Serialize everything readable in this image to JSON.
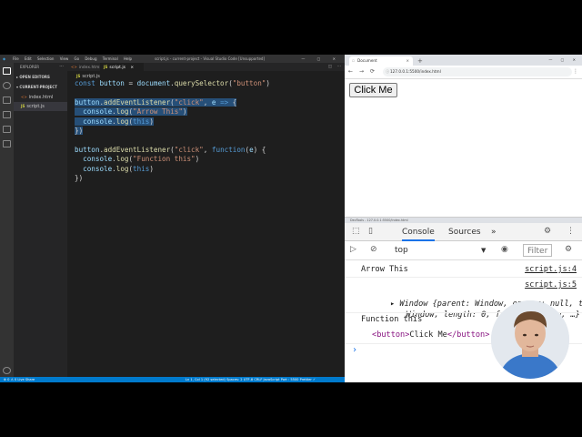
{
  "vscode": {
    "menu": [
      "File",
      "Edit",
      "Selection",
      "View",
      "Go",
      "Debug",
      "Terminal",
      "Help"
    ],
    "window_title": "script.js - current-project - Visual Studio Code [Unsupported]",
    "window_controls": "— ▢ ✕",
    "sidebar": {
      "header": "EXPLORER",
      "open_editors": "▸ OPEN EDITORS",
      "project": "▾ CURRENT-PROJECT",
      "files": [
        {
          "icon": "<>",
          "name": "index.html"
        },
        {
          "icon": "JS",
          "name": "script.js"
        }
      ]
    },
    "tabs": [
      {
        "icon": "<>",
        "label": "index.html"
      },
      {
        "icon": "JS",
        "label": "script.js"
      }
    ],
    "tab_close": "×",
    "breadcrumb": {
      "icon": "JS",
      "label": "script.js"
    },
    "code": [
      {
        "tokens": [
          {
            "t": "const ",
            "c": "kw"
          },
          {
            "t": "button",
            "c": "var"
          },
          {
            "t": " = "
          },
          {
            "t": "document",
            "c": "var"
          },
          {
            "t": "."
          },
          {
            "t": "querySelector",
            "c": "fn"
          },
          {
            "t": "("
          },
          {
            "t": "\"button\"",
            "c": "str"
          },
          {
            "t": ")"
          }
        ]
      },
      {
        "tokens": []
      },
      {
        "sel": true,
        "tokens": [
          {
            "t": "button",
            "c": "var"
          },
          {
            "t": "."
          },
          {
            "t": "addEventListener",
            "c": "fn"
          },
          {
            "t": "("
          },
          {
            "t": "\"click\"",
            "c": "str"
          },
          {
            "t": ", "
          },
          {
            "t": "e",
            "c": "var"
          },
          {
            "t": " "
          },
          {
            "t": "=>",
            "c": "kw"
          },
          {
            "t": " {"
          }
        ]
      },
      {
        "sel": true,
        "tokens": [
          {
            "t": "  "
          },
          {
            "t": "console",
            "c": "var"
          },
          {
            "t": "."
          },
          {
            "t": "log",
            "c": "fn"
          },
          {
            "t": "("
          },
          {
            "t": "\"Arrow This\"",
            "c": "str"
          },
          {
            "t": ")"
          }
        ]
      },
      {
        "sel": true,
        "tokens": [
          {
            "t": "  "
          },
          {
            "t": "console",
            "c": "var"
          },
          {
            "t": "."
          },
          {
            "t": "log",
            "c": "fn"
          },
          {
            "t": "("
          },
          {
            "t": "this",
            "c": "kw"
          },
          {
            "t": ")"
          }
        ]
      },
      {
        "sel": true,
        "tokens": [
          {
            "t": "})"
          }
        ]
      },
      {
        "tokens": []
      },
      {
        "tokens": [
          {
            "t": "button",
            "c": "var"
          },
          {
            "t": "."
          },
          {
            "t": "addEventListener",
            "c": "fn"
          },
          {
            "t": "("
          },
          {
            "t": "\"click\"",
            "c": "str"
          },
          {
            "t": ", "
          },
          {
            "t": "function",
            "c": "kw"
          },
          {
            "t": "("
          },
          {
            "t": "e",
            "c": "var"
          },
          {
            "t": ") {"
          }
        ]
      },
      {
        "tokens": [
          {
            "t": "  "
          },
          {
            "t": "console",
            "c": "var"
          },
          {
            "t": "."
          },
          {
            "t": "log",
            "c": "fn"
          },
          {
            "t": "("
          },
          {
            "t": "\"Function this\"",
            "c": "str"
          },
          {
            "t": ")"
          }
        ]
      },
      {
        "tokens": [
          {
            "t": "  "
          },
          {
            "t": "console",
            "c": "var"
          },
          {
            "t": "."
          },
          {
            "t": "log",
            "c": "fn"
          },
          {
            "t": "("
          },
          {
            "t": "this",
            "c": "kw"
          },
          {
            "t": ")"
          }
        ]
      },
      {
        "tokens": [
          {
            "t": "})"
          }
        ]
      }
    ],
    "status_left": "⊗ 0 ⚠ 0   Live Share",
    "status_right": "Ln 1, Col 1 (92 selected)   Spaces: 2   UTF-8   CRLF   JavaScript   Port : 5500   Prettier ✓"
  },
  "browser": {
    "tab_title": "Document",
    "tab_close": "×",
    "new_tab": "+",
    "window_controls": "— ▢ ✕",
    "nav": {
      "back": "←",
      "forward": "→",
      "reload": "⟳"
    },
    "lock": "ⓘ",
    "url": "127.0.0.1:5500/index.html",
    "menu": "⋮",
    "page_button": "Click Me"
  },
  "devtools": {
    "title": "DevTools - 127.0.0.1:5500/index.html",
    "tabs": [
      "Console",
      "Sources"
    ],
    "more_tabs": "»",
    "context": "top",
    "context_caret": "▼",
    "filter_placeholder": "Filter",
    "entries": [
      {
        "text": "Arrow This",
        "source": "script.js:4"
      },
      {
        "source": "script.js:5"
      },
      {
        "text": "▸ Window {parent: Window, opener: null, top:"
      },
      {
        "text": "  Window, length: 0, frames: Window, …}"
      },
      {
        "text": "Function this"
      },
      {
        "tag_open": "<",
        "tag_name": "button",
        "tag_close": ">",
        "text": "Click Me",
        "end_tag": "</button>"
      }
    ],
    "prompt": "›"
  },
  "colors": {
    "vscode_bg": "#1e1e1e",
    "vscode_status": "#007acc",
    "selection": "#264f78",
    "keyword": "#569cd6",
    "string": "#ce9178",
    "function": "#dcdcaa",
    "devtools_active_tab": "#1a73e8"
  }
}
